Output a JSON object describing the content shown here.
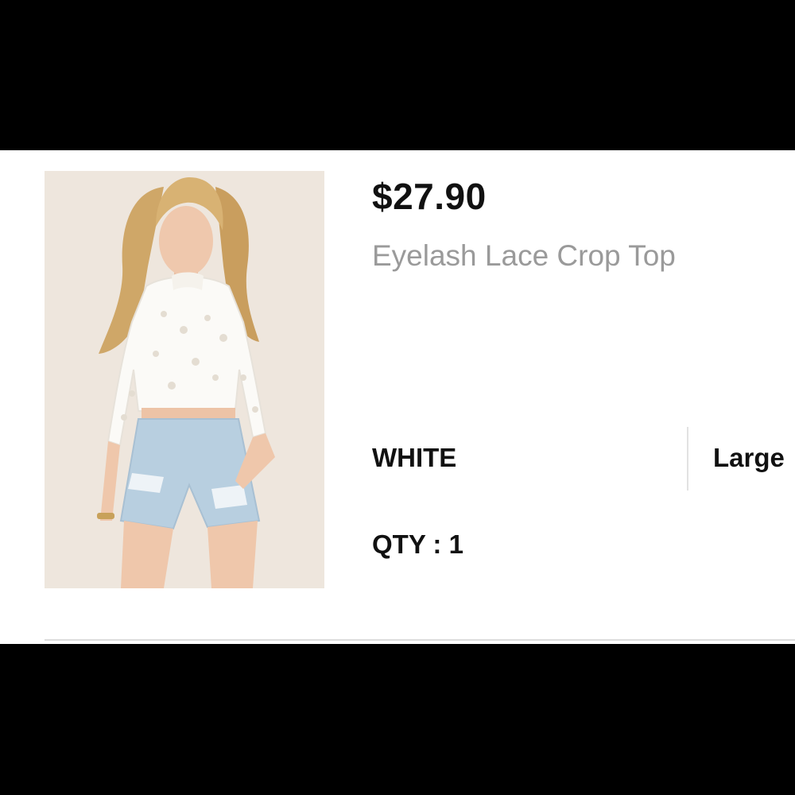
{
  "cart_item": {
    "price": "$27.90",
    "name": "Eyelash Lace Crop Top",
    "color": "WHITE",
    "size": "Large",
    "qty_label": "QTY : 1"
  },
  "colors": {
    "background": "#ffffff",
    "letterbox": "#000000",
    "price_text": "#111111",
    "name_text": "#9a9a9a",
    "divider": "#dcdcdc"
  }
}
